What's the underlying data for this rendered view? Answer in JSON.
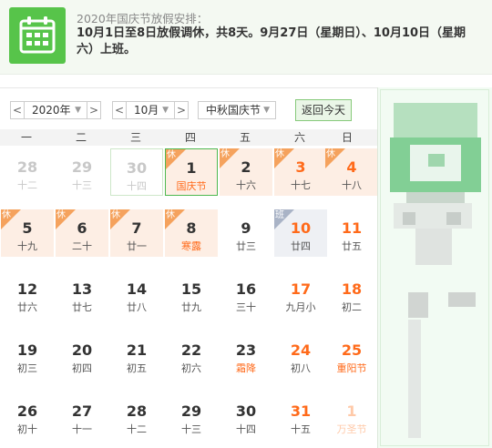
{
  "banner": {
    "title": "2020年国庆节放假安排：",
    "text": "10月1日至8日放假调休，共8天。9月27日（星期日）、10月10日（星期六）上班。"
  },
  "toolbar": {
    "prev_year": "<",
    "year": "2020年",
    "next_year": ">",
    "prev_month": "<",
    "month": "10月",
    "next_month": ">",
    "festival": "中秋国庆节",
    "today_button": "返回今天"
  },
  "weekdays": [
    "一",
    "二",
    "三",
    "四",
    "五",
    "六",
    "日"
  ],
  "tags": {
    "rest": "休",
    "work": "班"
  },
  "days": [
    {
      "day": "28",
      "lunar": "十二",
      "dim": true
    },
    {
      "day": "29",
      "lunar": "十三",
      "dim": true
    },
    {
      "day": "30",
      "lunar": "十四",
      "dim": true,
      "prevsel": true
    },
    {
      "day": "1",
      "lunar": "国庆节",
      "rest": true,
      "today": true,
      "fest": true
    },
    {
      "day": "2",
      "lunar": "十六",
      "rest": true
    },
    {
      "day": "3",
      "lunar": "十七",
      "rest": true,
      "weekend": true
    },
    {
      "day": "4",
      "lunar": "十八",
      "rest": true,
      "weekend": true
    },
    {
      "day": "5",
      "lunar": "十九",
      "rest": true
    },
    {
      "day": "6",
      "lunar": "二十",
      "rest": true
    },
    {
      "day": "7",
      "lunar": "廿一",
      "rest": true
    },
    {
      "day": "8",
      "lunar": "寒露",
      "rest": true,
      "fest": true
    },
    {
      "day": "9",
      "lunar": "廿三"
    },
    {
      "day": "10",
      "lunar": "廿四",
      "work": true,
      "weekend": true
    },
    {
      "day": "11",
      "lunar": "廿五",
      "weekend": true
    },
    {
      "day": "12",
      "lunar": "廿六"
    },
    {
      "day": "13",
      "lunar": "廿七"
    },
    {
      "day": "14",
      "lunar": "廿八"
    },
    {
      "day": "15",
      "lunar": "廿九"
    },
    {
      "day": "16",
      "lunar": "三十"
    },
    {
      "day": "17",
      "lunar": "九月小",
      "weekend": true
    },
    {
      "day": "18",
      "lunar": "初二",
      "weekend": true
    },
    {
      "day": "19",
      "lunar": "初三"
    },
    {
      "day": "20",
      "lunar": "初四"
    },
    {
      "day": "21",
      "lunar": "初五"
    },
    {
      "day": "22",
      "lunar": "初六"
    },
    {
      "day": "23",
      "lunar": "霜降",
      "fest": true
    },
    {
      "day": "24",
      "lunar": "初八",
      "weekend": true
    },
    {
      "day": "25",
      "lunar": "重阳节",
      "weekend": true,
      "fest": true
    },
    {
      "day": "26",
      "lunar": "初十"
    },
    {
      "day": "27",
      "lunar": "十一"
    },
    {
      "day": "28",
      "lunar": "十二"
    },
    {
      "day": "29",
      "lunar": "十三"
    },
    {
      "day": "30",
      "lunar": "十四"
    },
    {
      "day": "31",
      "lunar": "十五",
      "weekend": true
    },
    {
      "day": "1",
      "lunar": "万圣节",
      "dim": true,
      "weekend": true
    }
  ],
  "colors": {
    "accent_green": "#57c44a",
    "rest_bg": "#fdeee4",
    "rest_tag": "#f5a25d",
    "work_tag": "#a9b3c6",
    "weekend_red": "#ff6a1a"
  }
}
